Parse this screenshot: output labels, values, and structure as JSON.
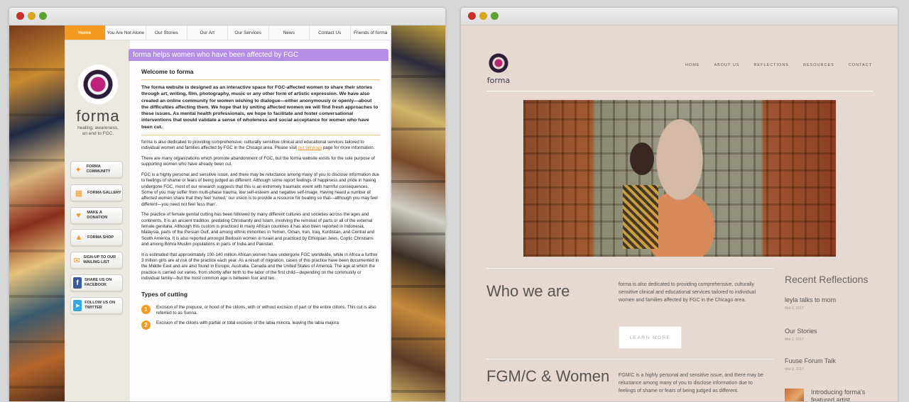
{
  "left_window": {
    "nav": [
      "Home",
      "You Are Not Alone",
      "Our Stories",
      "Our Art",
      "Our Services",
      "News",
      "Contact Us",
      "Friends of forma"
    ],
    "logo": {
      "word": "forma",
      "tagline": "healing, awareness,\nan end to FGC."
    },
    "side_buttons": [
      {
        "icon": "community-icon",
        "label": "FORMA COMMUNITY"
      },
      {
        "icon": "gallery-icon",
        "label": "FORMA GALLERY"
      },
      {
        "icon": "donation-icon",
        "label": "MAKE A DONATION"
      },
      {
        "icon": "shop-icon",
        "label": "FORMA SHOP"
      },
      {
        "icon": "mail-icon",
        "label": "SIGN-UP TO OUR MAILING LIST"
      },
      {
        "icon": "facebook-icon",
        "label": "SHARE US ON FACEBOOK"
      },
      {
        "icon": "twitter-icon",
        "label": "FOLLOW US ON TWITTER"
      }
    ],
    "banner": "forma helps women who have been affected by FGC",
    "welcome": "Welcome to forma",
    "intro": "The forma website is designed as an interactive space for FGC-affected women to share their stories through art, writing, film, photography, music or any other form of artistic expression. We have also created an online community for women wishing to dialogue—either anonymously or openly—about the difficulties affecting them. We hope that by uniting affected women we will find fresh approaches to these issues. As mental health professionals, we hope to facilitate and foster conversational interventions that would validate a sense of wholeness and social acceptance for women who have been cut.",
    "p1_before": "forma is also dedicated to providing comprehensive, culturally sensitive clinical and educational services tailored to individual women and families affected by FGC in the Chicago area. Please visit",
    "p1_link": "our services",
    "p1_after": "page for more information.",
    "p2": "There are many organizations which promote abandonment of FGC, but the forma website exists for the sole purpose of supporting women who have already been cut.",
    "p3": "FGC is a highly personal and sensitive issue, and there may be reluctance among many of you to disclose information due to feelings of shame or fears of being judged as different. Although some report feelings of happiness and pride in having undergone FGC, most of our research suggests that this is an extremely traumatic event with harmful consequences. Some of you may suffer from multi-phase trauma, low self-esteem and negative self-image. Having heard a number of affected women share that they feel 'ruined,' our vision is to provide a resource for healing so that—although you may feel different—you need not feel 'less than'.",
    "p4": "The practice of female genital cutting has been followed by many different cultures and societies across the ages and continents. It is an ancient tradition, predating Christianity and Islam, involving the removal of parts or all of the external female genitalia. Although this custom is practiced in many African countries it has also been reported in Indonesia, Malaysia, parts of the Persian Gulf, and among ethnic minorities in Yemen, Oman, Iran, Iraq, Kurdistan, and Central and South America. It is also reported amongst Bedouin women in Israel and practiced by Ethiopian Jews, Coptic Christians and among Bohra Muslim populations in parts of India and Pakistan.",
    "p5": "It is estimated that approximately 100-140 million African women have undergone FGC worldwide, while in Africa a further 3 million girls are at risk of the practice each year. As a result of migration, cases of this practice have been documented in the Middle East and are also found in Europe, Australia, Canada and the United States of America. The age at which the practice is carried out varies, from shortly after birth to the labor of the first child—depending on the community or individual family—but the most common age is between four and ten.",
    "types_title": "Types of cutting",
    "types": [
      {
        "num": "1",
        "text": "Excision of the prepuce, or hood of the clitoris, with or without excision of part or the entire clitoris. This cut is also referred to as Sunna."
      },
      {
        "num": "2",
        "text": "Excision of the clitoris with partial or total excision of the labia minora, leaving the labia majora"
      }
    ]
  },
  "right_window": {
    "logo_word": "forma",
    "nav": [
      "HOME",
      "ABOUT US",
      "REFLECTIONS",
      "RESOURCES",
      "CONTACT"
    ],
    "who_title": "Who we are",
    "who_text": "forma is also dedicated to providing comprehensive, culturally sensitive clinical and educational services tailored to individual women and families affected by FGC in the Chicago area.",
    "learn_more": "LEARN MORE",
    "fgm_title": "FGM/C & Women",
    "fgm_text": "FGM/C is a highly personal and sensitive issue, and there may be reluctance among many of you to disclose information due to feelings of shame or fears of being judged as different.",
    "recent_title": "Recent Reflections",
    "recent": [
      {
        "title": "leyla talks to mom",
        "date": "Mar 2, 2017"
      },
      {
        "title": "Our Stories",
        "date": "Mar 2, 2017"
      },
      {
        "title": "Fuuse Forum Talk",
        "date": "Mar 2, 2017"
      },
      {
        "title": "Introducing forma's featured artist",
        "date": ""
      }
    ]
  },
  "colors": {
    "accent_orange": "#f29a22",
    "banner_purple": "#b48ee4",
    "bg_new": "#e6d9d2",
    "logo_magenta": "#c0227a"
  }
}
